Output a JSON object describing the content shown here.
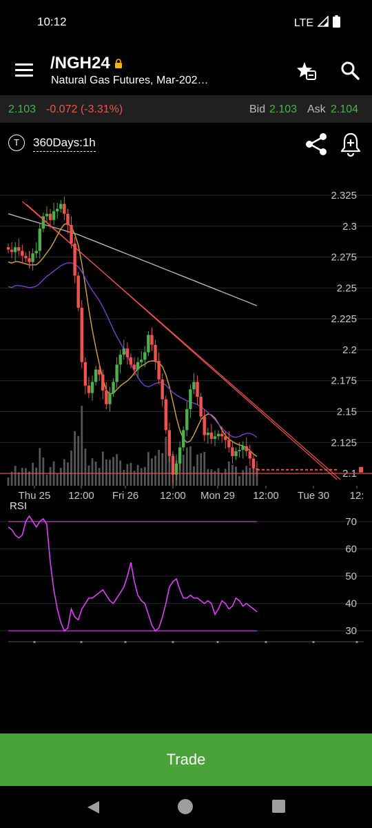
{
  "status": {
    "time": "10:12",
    "network": "LTE"
  },
  "header": {
    "symbol": "/NGH24",
    "description": "Natural Gas Futures, Mar-202…",
    "icons": [
      "menu-icon",
      "lock-icon",
      "watchlist-star-icon",
      "search-icon"
    ]
  },
  "quote": {
    "last": "2.103",
    "change": "-0.072 (-3.31%)",
    "bid_label": "Bid",
    "bid": "2.103",
    "ask_label": "Ask",
    "ask": "2.104"
  },
  "toolbar": {
    "tool_icon_label": "T",
    "timeframe": "360Days:1h",
    "icons": [
      "share-icon",
      "bell-plus-icon"
    ]
  },
  "chart_data": [
    {
      "type": "candlestick",
      "price_axis_labels": [
        "2.325",
        "2.3",
        "2.275",
        "2.25",
        "2.225",
        "2.2",
        "2.175",
        "2.15",
        "2.125",
        "2.1"
      ],
      "ylim": [
        2.09,
        2.33
      ],
      "x_tick_labels": [
        "Thu 25",
        "12:00",
        "Fri 26",
        "12:00",
        "Mon 29",
        "12:00",
        "Tue 30",
        "12:"
      ],
      "close": [
        2.281,
        2.279,
        2.283,
        2.28,
        2.276,
        2.274,
        2.271,
        2.278,
        2.28,
        2.298,
        2.308,
        2.31,
        2.305,
        2.312,
        2.314,
        2.318,
        2.31,
        2.301,
        2.286,
        2.26,
        2.234,
        2.19,
        2.171,
        2.165,
        2.174,
        2.184,
        2.18,
        2.167,
        2.156,
        2.165,
        2.174,
        2.188,
        2.196,
        2.201,
        2.194,
        2.188,
        2.184,
        2.19,
        2.192,
        2.198,
        2.212,
        2.204,
        2.191,
        2.176,
        2.16,
        2.135,
        2.114,
        2.099,
        2.108,
        2.121,
        2.135,
        2.152,
        2.168,
        2.174,
        2.162,
        2.146,
        2.131,
        2.133,
        2.128,
        2.13,
        2.132,
        2.13,
        2.127,
        2.121,
        2.114,
        2.118,
        2.119,
        2.122,
        2.118,
        2.112,
        2.104,
        2.103
      ],
      "last_price": "2.103",
      "moving_averages": [
        {
          "color": "#b5b5b5",
          "period": "long"
        },
        {
          "color": "#d6a83c",
          "period": "short"
        },
        {
          "color": "#7b3fc9",
          "period": "mid"
        }
      ],
      "trendline": {
        "x": [
          14,
          79
        ],
        "y": [
          2.32,
          2.095
        ]
      },
      "support_level": 2.1,
      "colors": {
        "up": "#4caf50",
        "down": "#ef5350",
        "volume": "#555555",
        "trend": "#ef5350",
        "bg": "#000000",
        "grid": "#2a2a2a",
        "axis": "#c8c8c8"
      },
      "grid": true
    },
    {
      "type": "line",
      "title": "RSI",
      "axis_labels": [
        "70",
        "60",
        "50",
        "40",
        "30"
      ],
      "ylim": [
        26,
        74
      ],
      "overbought": 70,
      "oversold": 30,
      "values": [
        68,
        67,
        65,
        64,
        65,
        70,
        72,
        70,
        68,
        70,
        71,
        69,
        55,
        45,
        38,
        33,
        30,
        31,
        38,
        35,
        34,
        38,
        40,
        42,
        42,
        43,
        44,
        45,
        43,
        41,
        40,
        42,
        44,
        46,
        50,
        55,
        48,
        43,
        41,
        40,
        36,
        32,
        30,
        31,
        35,
        40,
        46,
        48,
        49,
        45,
        42,
        42,
        43,
        42,
        42,
        41,
        40,
        41,
        40,
        36,
        38,
        41,
        40,
        38,
        39,
        42,
        41,
        39,
        40,
        39,
        38,
        37
      ],
      "color": "#e040fb",
      "level_color": "#9c27b0"
    }
  ],
  "trade_button": {
    "label": "Trade"
  },
  "nav": {
    "icons": [
      "back-icon",
      "home-icon",
      "recents-icon"
    ]
  }
}
